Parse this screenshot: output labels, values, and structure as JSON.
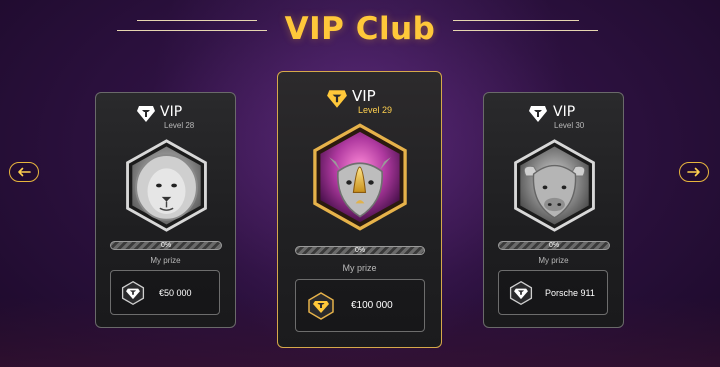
{
  "title": "VIP Club",
  "nav": {
    "prev_icon": "arrow-left-icon",
    "next_icon": "arrow-right-icon",
    "accent": "#e7b53d"
  },
  "cards": [
    {
      "vip_label": "VIP",
      "level": "Level 28",
      "animal_icon": "lion-icon",
      "progress_text": "0%",
      "progress_value": 0,
      "prize_label": "My prize",
      "prize_value": "€50 000",
      "prize_icon": "vip-diamond-icon"
    },
    {
      "vip_label": "VIP",
      "level": "Level 29",
      "animal_icon": "rhino-icon",
      "progress_text": "0%",
      "progress_value": 0,
      "prize_label": "My prize",
      "prize_value": "€100 000",
      "prize_icon": "vip-diamond-icon"
    },
    {
      "vip_label": "VIP",
      "level": "Level 30",
      "animal_icon": "buffalo-icon",
      "progress_text": "0%",
      "progress_value": 0,
      "prize_label": "My prize",
      "prize_value": "Porsche 911",
      "prize_icon": "vip-diamond-icon"
    }
  ],
  "colors": {
    "gold": "#ffc83a",
    "card_border": "#6a6a6a",
    "active_border": "#d6a94a",
    "background": "#2d1140"
  }
}
